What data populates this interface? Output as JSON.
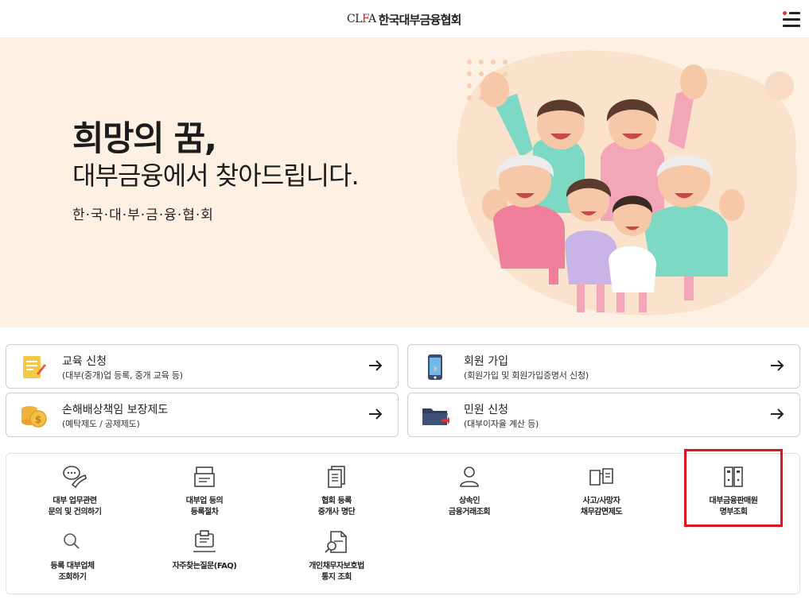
{
  "header": {
    "logo_mark_prefix": "CL",
    "logo_mark_red": "F",
    "logo_mark_suffix": "A",
    "logo_text": "한국대부금융협회",
    "menu_icon": "hamburger-menu-icon"
  },
  "hero": {
    "title": "희망의 꿈,",
    "subtitle": "대부금융에서 찾아드립니다.",
    "org": "한·국·대·부·금·융·협·회",
    "illustration": "happy-family-illustration"
  },
  "quick_cards": [
    {
      "title": "교육 신청",
      "desc": "(대부(중개)업 등록, 중개 교육 등)",
      "icon": "education-form-icon"
    },
    {
      "title": "회원 가입",
      "desc": "(회원가입 및 회원가입증명서 신청)",
      "icon": "mobile-phone-icon"
    },
    {
      "title": "손해배상책임 보장제도",
      "desc": "(예탁제도 / 공제제도)",
      "icon": "coins-icon"
    },
    {
      "title": "민원 신청",
      "desc": "(대부이자율 계산 등)",
      "icon": "folder-icon"
    }
  ],
  "services": [
    {
      "label1": "대부 업무관련",
      "label2": "문의 및 건의하기",
      "icon": "chat-phone-icon"
    },
    {
      "label1": "대부업 등의",
      "label2": "등록절차",
      "icon": "document-stack-icon"
    },
    {
      "label1": "협회 등록",
      "label2": "중개사 명단",
      "icon": "copy-list-icon"
    },
    {
      "label1": "상속인",
      "label2": "금융거래조회",
      "icon": "person-icon"
    },
    {
      "label1": "사고/사망자",
      "label2": "채무감면제도",
      "icon": "book-icon"
    },
    {
      "label1": "대부금융판매원",
      "label2": "명부조회",
      "icon": "binder-icon"
    },
    {
      "label1": "등록 대부업체",
      "label2": "조회하기",
      "icon": "search-icon"
    },
    {
      "label1": "자주찾는질문(FAQ)",
      "label2": "",
      "icon": "faq-board-icon"
    },
    {
      "label1": "개인채무자보호법",
      "label2": "통지 조회",
      "icon": "document-search-icon"
    }
  ],
  "colors": {
    "hero_bg": "#fcf1e3",
    "brand_red": "#d8232a",
    "highlight_red": "#e0141e"
  }
}
